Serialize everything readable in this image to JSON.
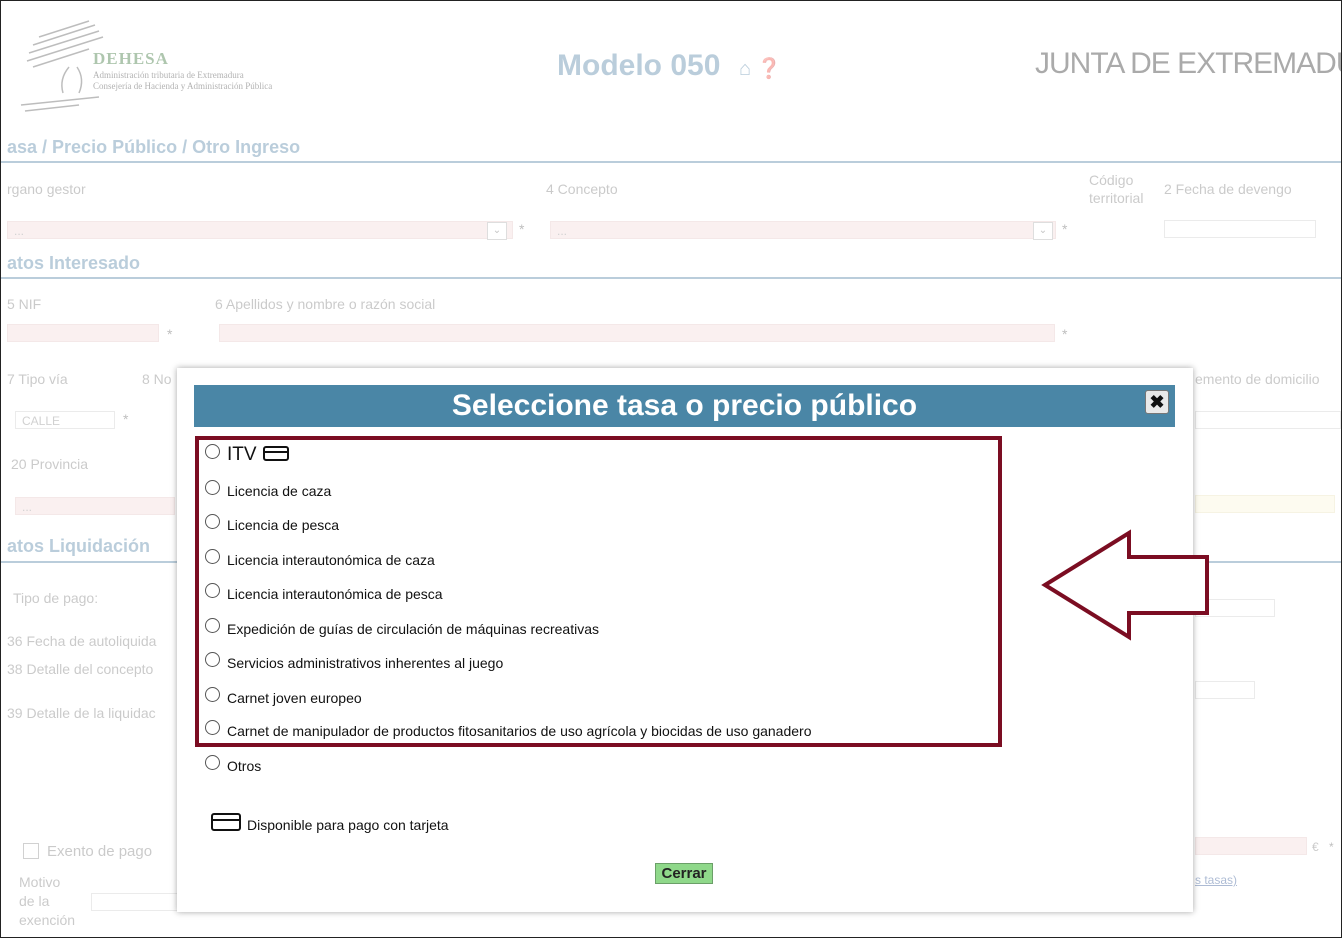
{
  "header": {
    "logo_title": "DEHESA",
    "logo_sub1": "Administración tributaria de Extremadura",
    "logo_sub2": "Consejería de Hacienda y Administración Pública",
    "modelo": "Modelo 050",
    "brand": "JUNTA DE EXTREMADURA"
  },
  "form": {
    "section1": "asa / Precio Público / Otro Ingreso",
    "organo_label": "rgano gestor",
    "concepto_label": "4 Concepto",
    "codigo_label_1": "Código",
    "codigo_label_2": "territorial",
    "fecha_label": "2 Fecha de devengo",
    "select_placeholder": "...",
    "required_mark": "*",
    "section2": "atos Interesado",
    "nif_label": "5 NIF",
    "apellidos_label": "6 Apellidos y nombre o razón social",
    "tipo_via_label": "7 Tipo vía",
    "nombre_via_label": "8 No",
    "complemento_label": "emento de domicilio",
    "tipo_via_value": "CALLE",
    "provincia_label": "20 Provincia",
    "section3": "atos Liquidación",
    "tipo_pago_label": "Tipo de pago:",
    "fecha_autoliq_label": "36 Fecha de autoliquida",
    "detalle_concepto_label": "38 Detalle del concepto",
    "detalle_liquidacion_label": "39 Detalle de la liquidac",
    "exento_label": "Exento de pago",
    "motivo_label_1": "Motivo",
    "motivo_label_2": "de la",
    "motivo_label_3": "exención",
    "euro_mark": "€",
    "tasas_link": "s tasas)"
  },
  "dialog": {
    "title": "Seleccione tasa o precio público",
    "close_icon": "close-x",
    "options": [
      {
        "label": "ITV",
        "card": true
      },
      {
        "label": "Licencia de caza"
      },
      {
        "label": "Licencia de pesca"
      },
      {
        "label": "Licencia interautonómica de caza"
      },
      {
        "label": "Licencia interautonómica de pesca"
      },
      {
        "label": "Expedición de guías de circulación de máquinas recreativas"
      },
      {
        "label": "Servicios administrativos inherentes al juego"
      },
      {
        "label": "Carnet joven europeo"
      },
      {
        "label": "Carnet de manipulador de productos fitosanitarios de uso agrícola y biocidas de uso ganadero"
      },
      {
        "label": "Otros"
      }
    ],
    "legend": "Disponible para pago con tarjeta",
    "close_button": "Cerrar",
    "highlight_color": "#7b0d22",
    "title_color": "#4a86a6"
  }
}
